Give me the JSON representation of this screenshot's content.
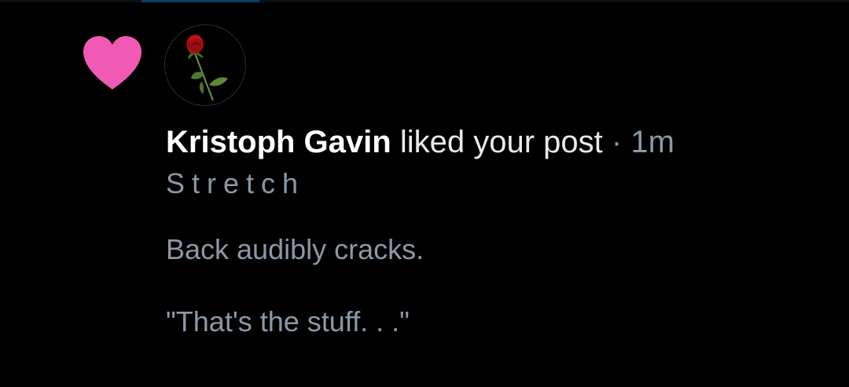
{
  "notification": {
    "icon": "heart-icon",
    "icon_color": "#f05ab4",
    "avatar": "rose-avatar",
    "actor_name": "Kristoph Gavin",
    "action_text": "liked your post",
    "separator": "·",
    "time_ago": "1m",
    "post_title": "Stretch",
    "post_lines": [
      "Back audibly cracks.",
      "\"That's the stuff. . .\""
    ]
  },
  "colors": {
    "background": "#000000",
    "primary_text": "#e7e9ea",
    "secondary_text": "#8b98a5"
  }
}
